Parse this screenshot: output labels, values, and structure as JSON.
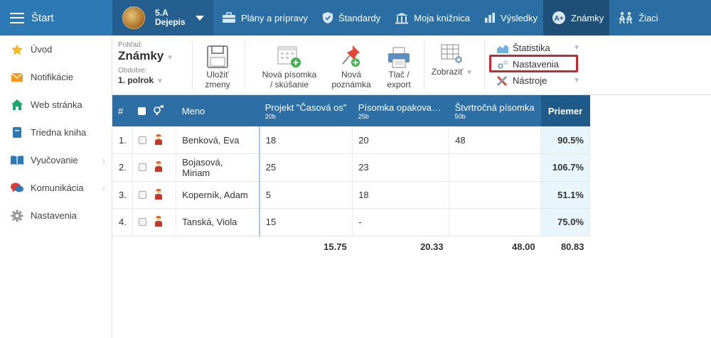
{
  "topbar": {
    "start_label": "Štart",
    "class_name": "5.A",
    "class_subject": "Dejepis",
    "nav": [
      {
        "label": "Plány a prípravy",
        "icon": "briefcase-icon"
      },
      {
        "label": "Štandardy",
        "icon": "shield-icon"
      },
      {
        "label": "Moja knižnica",
        "icon": "library-icon"
      },
      {
        "label": "Výsledky",
        "icon": "bar-chart-icon"
      },
      {
        "label": "Známky",
        "icon": "grades-icon",
        "active": true
      },
      {
        "label": "Žiaci",
        "icon": "students-icon"
      }
    ]
  },
  "sidebar": {
    "items": [
      {
        "label": "Úvod",
        "icon": "star-icon"
      },
      {
        "label": "Notifikácie",
        "icon": "envelope-icon"
      },
      {
        "label": "Web stránka",
        "icon": "home-icon"
      },
      {
        "label": "Triedna kniha",
        "icon": "book-icon"
      },
      {
        "label": "Vyučovanie",
        "icon": "open-book-icon",
        "has_submenu": true
      },
      {
        "label": "Komunikácia",
        "icon": "chat-icon",
        "has_submenu": true
      },
      {
        "label": "Nastavenia",
        "icon": "gear-icon"
      }
    ]
  },
  "toolbar": {
    "view_label": "Pohľad:",
    "view_value": "Známky",
    "period_label": "Obdobie:",
    "period_value": "1. polrok",
    "save_line1": "Uložiť",
    "save_line2": "zmeny",
    "newtest_line1": "Nová písomka",
    "newtest_line2": "/ skúšanie",
    "newnote_line1": "Nová",
    "newnote_line2": "poznámka",
    "print_line1": "Tlač /",
    "print_line2": "export",
    "show_label": "Zobraziť",
    "menu": {
      "statistics": "Štatistika",
      "settings": "Nastavenia",
      "tools": "Nástroje"
    }
  },
  "grid": {
    "headers": {
      "index": "#",
      "name": "Meno",
      "col1_title": "Projekt \"Časová os\"",
      "col1_sub": "20b",
      "col2_title": "Písomka opakova…",
      "col2_sub": "25b",
      "col3_title": "Štvrtročná písomka",
      "col3_sub": "50b",
      "average": "Priemer"
    },
    "rows": [
      {
        "num": "1.",
        "name": "Benková, Eva",
        "c1": "18",
        "c2": "20",
        "c3": "48",
        "avg": "90.5%"
      },
      {
        "num": "2.",
        "name": "Bojasová, Miriam",
        "c1": "25",
        "c2": "23",
        "c3": "",
        "avg": "106.7%"
      },
      {
        "num": "3.",
        "name": "Koperník, Adam",
        "c1": "5",
        "c2": "18",
        "c3": "",
        "avg": "51.1%"
      },
      {
        "num": "4.",
        "name": "Tanská, Viola",
        "c1": "15",
        "c2": "-",
        "c3": "",
        "avg": "75.0%"
      }
    ],
    "totals": {
      "c1": "15.75",
      "c2": "20.33",
      "c3": "48.00",
      "avg": "80.83"
    }
  }
}
